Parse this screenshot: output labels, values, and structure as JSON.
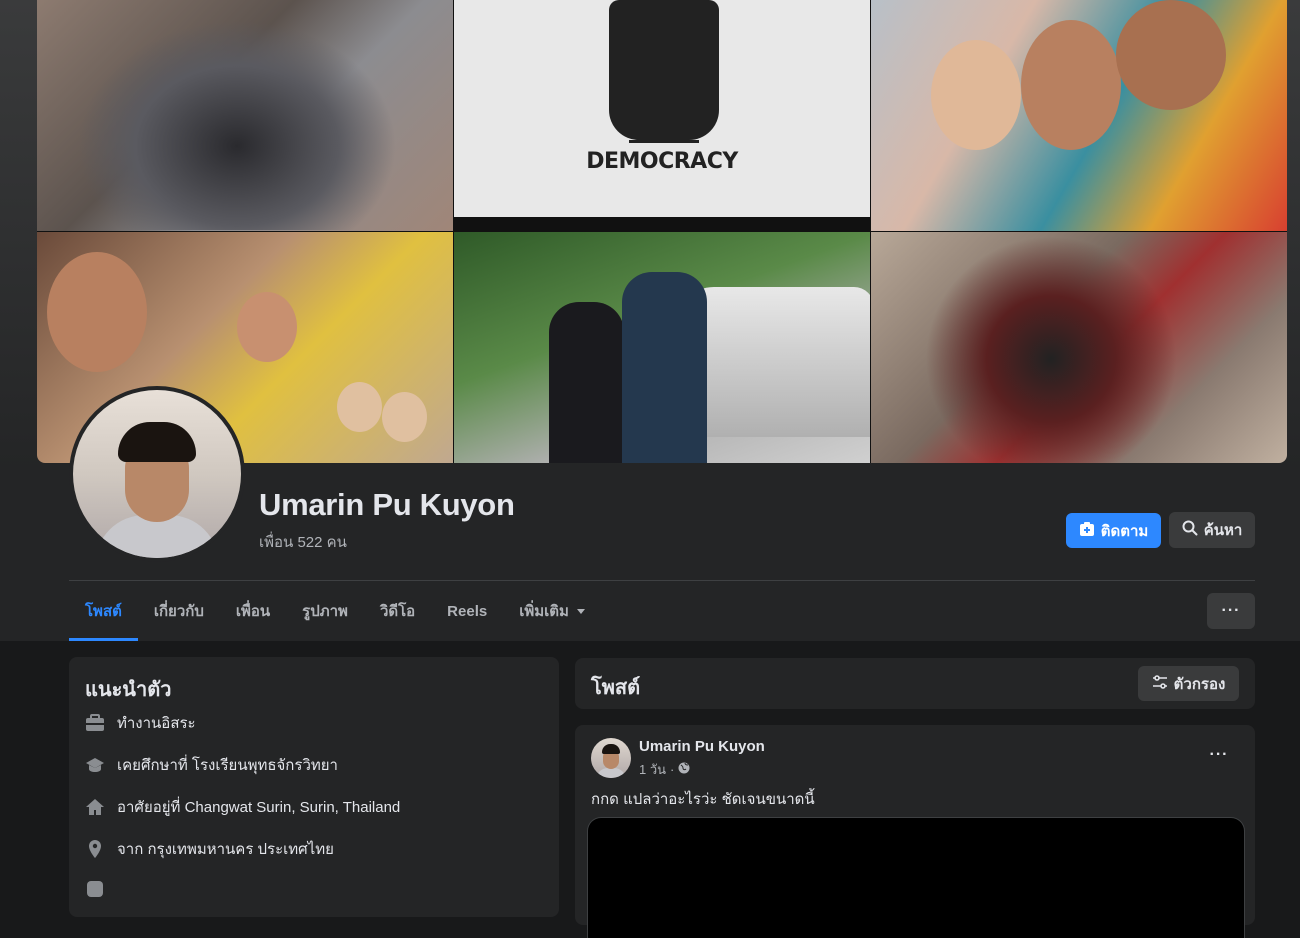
{
  "profile": {
    "name": "Umarin Pu Kuyon",
    "friends_text": "เพื่อน 522 คน",
    "follow_label": "ติดตาม",
    "search_label": "ค้นหา"
  },
  "cover": {
    "democracy_text": "DEMOCRACY"
  },
  "tabs": [
    {
      "label": "โพสต์",
      "active": true
    },
    {
      "label": "เกี่ยวกับ"
    },
    {
      "label": "เพื่อน"
    },
    {
      "label": "รูปภาพ"
    },
    {
      "label": "วิดีโอ"
    },
    {
      "label": "Reels"
    },
    {
      "label": "เพิ่มเติม"
    }
  ],
  "intro": {
    "title": "แนะนำตัว",
    "items": [
      {
        "icon": "briefcase-icon",
        "text": "ทำงานอิสระ"
      },
      {
        "icon": "graduation-cap-icon",
        "text": "เคยศึกษาที่ โรงเรียนพุทธจักรวิทยา"
      },
      {
        "icon": "home-icon",
        "text": "อาศัยอยู่ที่ Changwat Surin, Surin, Thailand"
      },
      {
        "icon": "location-pin-icon",
        "text": "จาก กรุงเทพมหานคร ประเทศไทย"
      }
    ]
  },
  "posts": {
    "title": "โพสต์",
    "filter_label": "ตัวกรอง",
    "items": [
      {
        "author": "Umarin Pu Kuyon",
        "time": "1 วัน",
        "separator": "·",
        "privacy_icon": "globe-icon",
        "text": "กกด แปลว่าอะไรว่ะ ชัดเจนขนาดนี้"
      }
    ]
  },
  "colors": {
    "accent": "#2d88ff",
    "background": "#18191a",
    "card": "#242526",
    "button": "#3a3b3c"
  }
}
